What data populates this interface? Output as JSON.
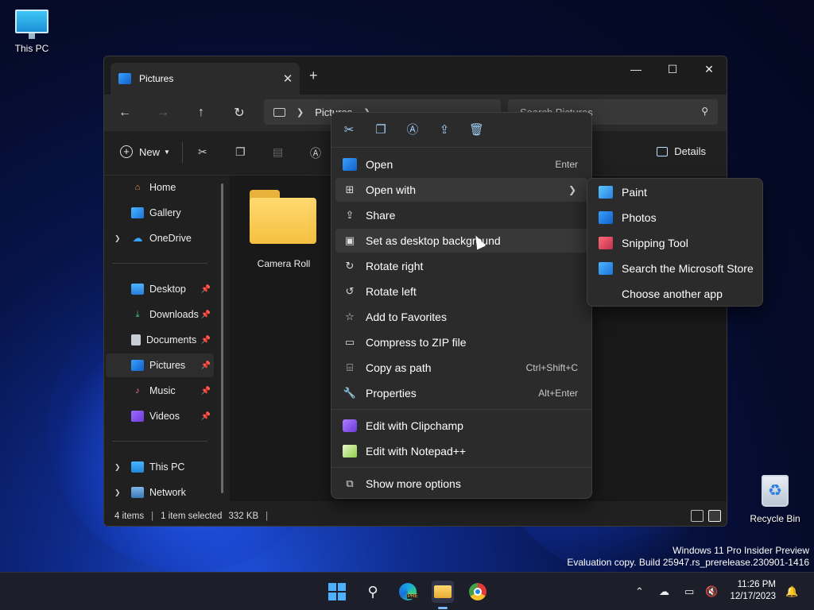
{
  "desktop": {
    "this_pc": "This PC",
    "recycle_bin": "Recycle Bin",
    "watermark_line1": "Windows 11 Pro Insider Preview",
    "watermark_line2": "Evaluation copy. Build 25947.rs_prerelease.230901-1416"
  },
  "window": {
    "tab_title": "Pictures",
    "close_tab": "✕",
    "new_tab": "+",
    "minimize": "—",
    "maximize": "☐",
    "close": "✕"
  },
  "navbar": {
    "breadcrumb": "Pictures",
    "search_placeholder": "Search Pictures"
  },
  "toolbar": {
    "new_label": "New",
    "details_label": "Details"
  },
  "sidebar": {
    "items": [
      {
        "label": "Home"
      },
      {
        "label": "Gallery"
      },
      {
        "label": "OneDrive"
      },
      {
        "label": "Desktop"
      },
      {
        "label": "Downloads"
      },
      {
        "label": "Documents"
      },
      {
        "label": "Pictures"
      },
      {
        "label": "Music"
      },
      {
        "label": "Videos"
      },
      {
        "label": "This PC"
      },
      {
        "label": "Network"
      }
    ]
  },
  "content": {
    "folder_name": "Camera Roll"
  },
  "status": {
    "count": "4 items",
    "selection": "1 item selected",
    "size": "332 KB"
  },
  "context_menu": {
    "items": [
      {
        "label": "Open",
        "shortcut": "Enter"
      },
      {
        "label": "Open with"
      },
      {
        "label": "Share"
      },
      {
        "label": "Set as desktop background"
      },
      {
        "label": "Rotate right"
      },
      {
        "label": "Rotate left"
      },
      {
        "label": "Add to Favorites"
      },
      {
        "label": "Compress to ZIP file"
      },
      {
        "label": "Copy as path",
        "shortcut": "Ctrl+Shift+C"
      },
      {
        "label": "Properties",
        "shortcut": "Alt+Enter"
      },
      {
        "label": "Edit with Clipchamp"
      },
      {
        "label": "Edit with Notepad++"
      },
      {
        "label": "Show more options"
      }
    ]
  },
  "submenu": {
    "items": [
      {
        "label": "Paint"
      },
      {
        "label": "Photos"
      },
      {
        "label": "Snipping Tool"
      },
      {
        "label": "Search the Microsoft Store"
      },
      {
        "label": "Choose another app"
      }
    ]
  },
  "taskbar": {
    "time": "11:26 PM",
    "date": "12/17/2023",
    "edge_badge": "PRE"
  },
  "colors": {
    "accent": "#4cb0ff",
    "folder": "#f5c040",
    "menu_bg": "#2b2b2b"
  }
}
